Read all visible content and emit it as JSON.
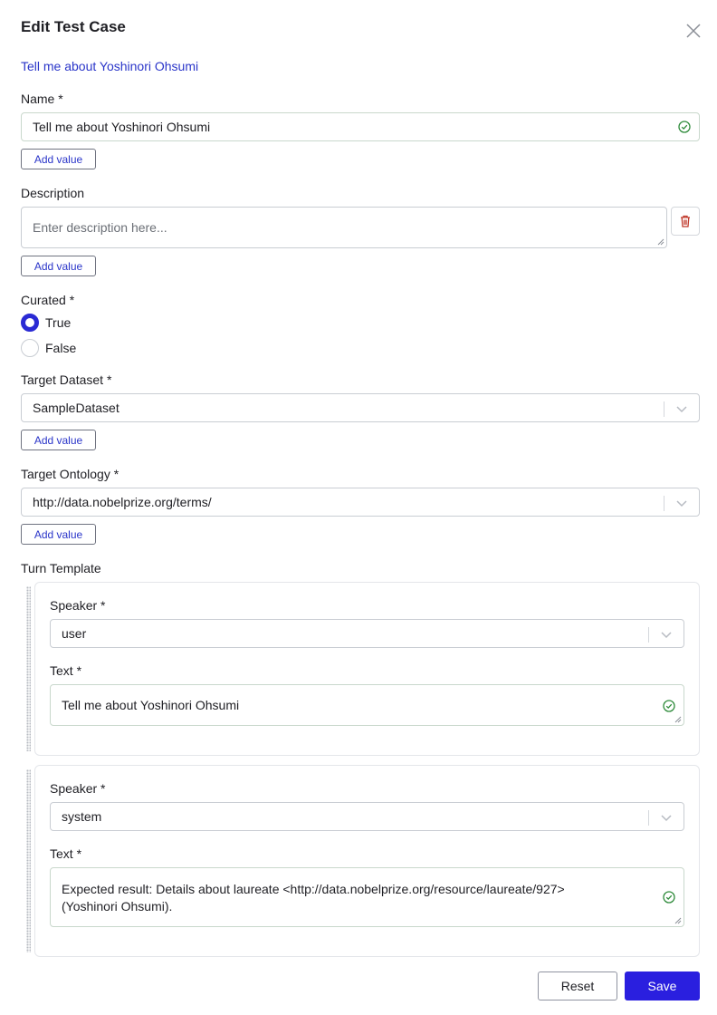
{
  "dialog": {
    "title": "Edit Test Case",
    "subtitle_link": "Tell me about Yoshinori Ohsumi"
  },
  "add_value_label": "Add value",
  "name_field": {
    "label": "Name *",
    "value": "Tell me about Yoshinori Ohsumi"
  },
  "description_field": {
    "label": "Description",
    "placeholder": "Enter description here..."
  },
  "curated": {
    "label": "Curated *",
    "options": [
      "True",
      "False"
    ],
    "selected": "True"
  },
  "target_dataset": {
    "label": "Target Dataset *",
    "value": "SampleDataset"
  },
  "target_ontology": {
    "label": "Target Ontology *",
    "value": "http://data.nobelprize.org/terms/"
  },
  "turn_template": {
    "label": "Turn Template",
    "turns": [
      {
        "speaker_label": "Speaker *",
        "speaker": "user",
        "text_label": "Text *",
        "text": "Tell me about Yoshinori Ohsumi"
      },
      {
        "speaker_label": "Speaker *",
        "speaker": "system",
        "text_label": "Text *",
        "text_line1": "Expected result: Details about laureate <http://data.nobelprize.org/resource/laureate/927>",
        "text_line2": "(Yoshinori Ohsumi)."
      }
    ]
  },
  "footer": {
    "reset_label": "Reset",
    "save_label": "Save"
  },
  "colors": {
    "accent": "#2a1fdf",
    "link": "#2a35c9",
    "valid_check": "#2e8b3a",
    "danger": "#c0392b"
  }
}
